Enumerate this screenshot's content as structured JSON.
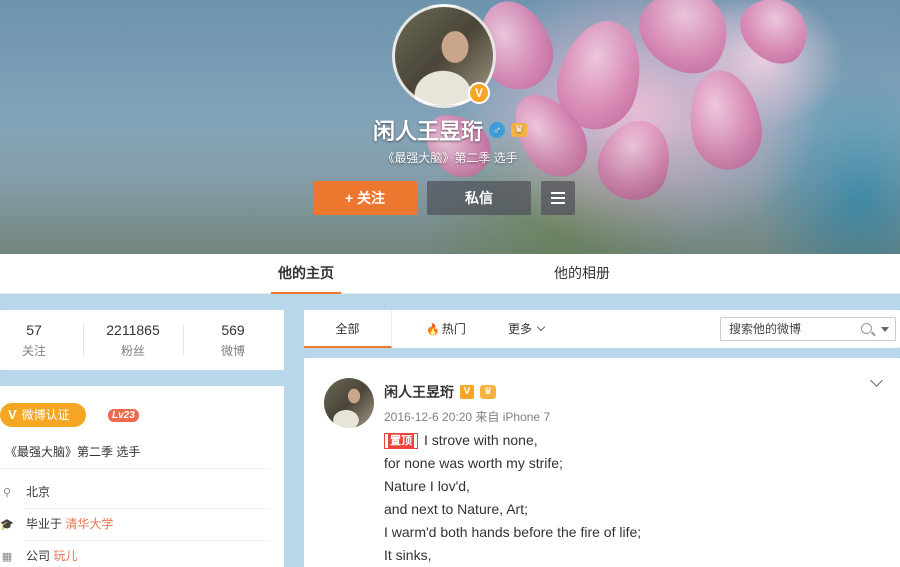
{
  "profile": {
    "name": "闲人王昱珩",
    "verified_badge": "V",
    "gender_icon": "♂",
    "crown_icon": "♛",
    "description": "《最强大脑》第二季 选手",
    "follow_label": "+ 关注",
    "message_label": "私信",
    "more_icon": "menu-icon"
  },
  "nav": {
    "tabs": [
      {
        "label": "他的主页",
        "active": true
      },
      {
        "label": "他的相册",
        "active": false
      }
    ]
  },
  "stats": [
    {
      "value": "57",
      "label": "关注"
    },
    {
      "value": "2211865",
      "label": "粉丝"
    },
    {
      "value": "569",
      "label": "微博"
    }
  ],
  "info": {
    "verify_label": "微博认证",
    "verify_icon": "V",
    "level": "Lv23",
    "description": "《最强大脑》第二季 选手",
    "location": "北京",
    "school_prefix": "毕业于",
    "school": "清华大学",
    "company_prefix": "公司",
    "company": "玩儿"
  },
  "feed_bar": {
    "all_label": "全部",
    "hot_label": "热门",
    "more_label": "更多",
    "search_placeholder": "搜索他的微博"
  },
  "post": {
    "author": "闲人王昱珩",
    "v_badge": "V",
    "meta": "2016-12-6 20:20 来自 iPhone 7",
    "top_tag": "置顶",
    "lines": [
      "I strove with none,",
      "for none was worth my strife;",
      "Nature I lov'd,",
      "and next to Nature, Art;",
      "I warm'd both hands before the fire of life;",
      "It sinks,"
    ]
  },
  "colors": {
    "accent": "#ee7730",
    "verify": "#f5a623",
    "link": "#eb7350",
    "page_bg": "#b9d7ea"
  }
}
